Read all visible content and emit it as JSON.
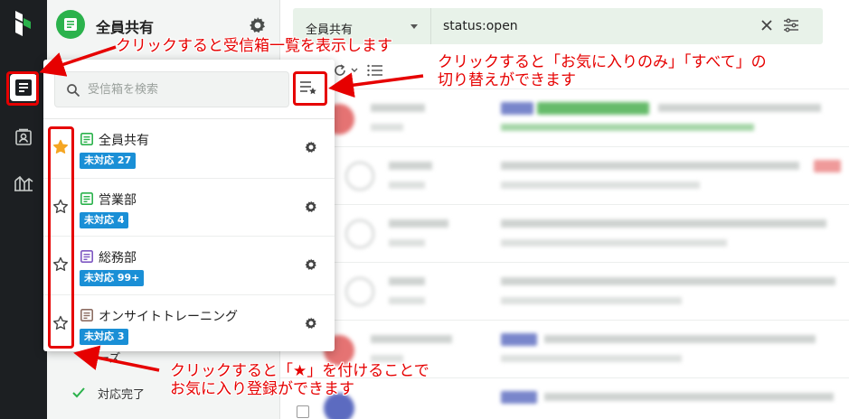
{
  "header": {
    "inbox_title": "全員共有"
  },
  "topbar": {
    "inbox_select": "全員共有",
    "search_query": "status:open"
  },
  "popup": {
    "search_placeholder": "受信箱を検索",
    "inboxes": [
      {
        "name": "全員共有",
        "badge": "未対応 27",
        "starred": true,
        "icon_color": "#2bb24c"
      },
      {
        "name": "営業部",
        "badge": "未対応 4",
        "starred": false,
        "icon_color": "#2bb24c"
      },
      {
        "name": "総務部",
        "badge": "未対応 99+",
        "starred": false,
        "icon_color": "#7e57c2"
      },
      {
        "name": "オンサイトトレーニング",
        "badge": "未対応 3",
        "starred": false,
        "icon_color": "#8d6e63"
      }
    ]
  },
  "sidebar": {
    "partial_item": "ーズ",
    "done_item": "対応完了"
  },
  "annotations": {
    "inbox_list": "クリックすると受信箱一覧を表示します",
    "favorites_toggle_line1": "クリックすると「お気に入りのみ」「すべて」の",
    "favorites_toggle_line2": "切り替えができます",
    "star_line1": "クリックすると「★」を付けることで",
    "star_line2": "お気に入り登録ができます"
  },
  "colors": {
    "rail": "#1c1f22",
    "brand_green": "#2bb24c",
    "badge_blue": "#1a8fd6",
    "star_gold": "#f5a623",
    "annotation_red": "#e60000"
  }
}
